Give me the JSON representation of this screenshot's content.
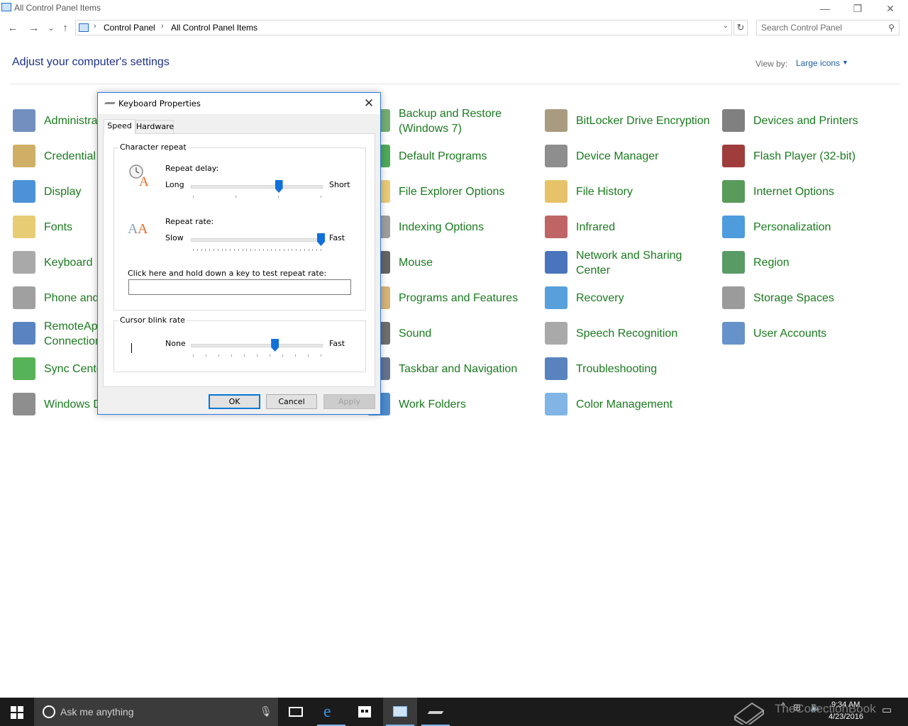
{
  "window": {
    "title": "All Control Panel Items",
    "minimize_glyph": "—",
    "restore_glyph": "❐",
    "close_glyph": "✕"
  },
  "nav": {
    "back_glyph": "←",
    "forward_glyph": "→",
    "recent_glyph": "⌄",
    "up_glyph": "↑",
    "breadcrumb": [
      "Control Panel",
      "All Control Panel Items"
    ],
    "crumb_separator": "›",
    "dropdown_glyph": "⌄",
    "refresh_glyph": "↻"
  },
  "search": {
    "placeholder": "Search Control Panel",
    "icon_glyph": "⚲"
  },
  "heading": "Adjust your computer's settings",
  "viewby": {
    "label": "View by:",
    "value": "Large icons",
    "caret": "▼"
  },
  "items": [
    {
      "label": "Administrative Tools",
      "icon": "administrative-tools-icon",
      "color": "#5a7bb5"
    },
    {
      "label": "Credential Manager",
      "icon": "credential-manager-icon",
      "color": "#c7a04a"
    },
    {
      "label": "Display",
      "icon": "display-icon",
      "color": "#2d7fd1"
    },
    {
      "label": "Fonts",
      "icon": "fonts-icon",
      "color": "#e3c35a"
    },
    {
      "label": "Keyboard",
      "icon": "keyboard-icon",
      "color": "#9a9a9a"
    },
    {
      "label": "Phone and Modem",
      "icon": "phone-modem-icon",
      "color": "#8f8f8f"
    },
    {
      "label": "RemoteApp and Desktop Connections",
      "icon": "remoteapp-icon",
      "color": "#3d6fb6"
    },
    {
      "label": "Sync Center",
      "icon": "sync-center-icon",
      "color": "#3aa63a"
    },
    {
      "label": "Windows Defender",
      "icon": "windows-defender-icon",
      "color": "#7a7a7a"
    },
    {
      "label": "Backup and Restore (Windows 7)",
      "icon": "backup-restore-icon",
      "color": "#5aa05a"
    },
    {
      "label": "Default Programs",
      "icon": "default-programs-icon",
      "color": "#2f9b3c"
    },
    {
      "label": "File Explorer Options",
      "icon": "file-explorer-options-icon",
      "color": "#e5c15f"
    },
    {
      "label": "Indexing Options",
      "icon": "indexing-options-icon",
      "color": "#8d8d8d"
    },
    {
      "label": "Mouse",
      "icon": "mouse-icon",
      "color": "#4a4a4a"
    },
    {
      "label": "Programs and Features",
      "icon": "programs-features-icon",
      "color": "#cfa65e"
    },
    {
      "label": "Sound",
      "icon": "sound-icon",
      "color": "#555555"
    },
    {
      "label": "Taskbar and Navigation",
      "icon": "taskbar-navigation-icon",
      "color": "#4a5a7a"
    },
    {
      "label": "Work Folders",
      "icon": "work-folders-icon",
      "color": "#2f78c4"
    },
    {
      "label": "BitLocker Drive Encryption",
      "icon": "bitlocker-icon",
      "color": "#9a8a6a"
    },
    {
      "label": "Device Manager",
      "icon": "device-manager-icon",
      "color": "#7a7a7a"
    },
    {
      "label": "File History",
      "icon": "file-history-icon",
      "color": "#e2b94e"
    },
    {
      "label": "Infrared",
      "icon": "infrared-icon",
      "color": "#b54a4a"
    },
    {
      "label": "Network and Sharing Center",
      "icon": "network-sharing-icon",
      "color": "#2a5db0"
    },
    {
      "label": "Recovery",
      "icon": "recovery-icon",
      "color": "#3a8fd6"
    },
    {
      "label": "Speech Recognition",
      "icon": "speech-recognition-icon",
      "color": "#9a9a9a"
    },
    {
      "label": "Troubleshooting",
      "icon": "troubleshooting-icon",
      "color": "#3b6db3"
    },
    {
      "label": "Color Management",
      "icon": "color-management-icon",
      "color": "#6aa8e0"
    },
    {
      "label": "Devices and Printers",
      "icon": "devices-printers-icon",
      "color": "#6a6a6a"
    },
    {
      "label": "Flash Player (32-bit)",
      "icon": "flash-player-icon",
      "color": "#8e1b1b"
    },
    {
      "label": "Internet Options",
      "icon": "internet-options-icon",
      "color": "#3c8a3c"
    },
    {
      "label": "Personalization",
      "icon": "personalization-icon",
      "color": "#2f8ad8"
    },
    {
      "label": "Region",
      "icon": "region-icon",
      "color": "#3b8a4a"
    },
    {
      "label": "Storage Spaces",
      "icon": "storage-spaces-icon",
      "color": "#8a8a8a"
    },
    {
      "label": "User Accounts",
      "icon": "user-accounts-icon",
      "color": "#4c7fbf"
    }
  ],
  "dialog": {
    "title": "Keyboard Properties",
    "close_glyph": "✕",
    "tabs": [
      "Speed",
      "Hardware"
    ],
    "char_repeat": {
      "legend": "Character repeat",
      "delay_label": "Repeat delay:",
      "delay_left": "Long",
      "delay_right": "Short",
      "delay_level": 0.67,
      "delay_ticks": 4,
      "rate_label": "Repeat rate:",
      "rate_left": "Slow",
      "rate_right": "Fast",
      "rate_level": 1.0,
      "rate_ticks": 32,
      "test_label": "Click here and hold down a key to test repeat rate:",
      "test_value": ""
    },
    "cursor_blink": {
      "legend": "Cursor blink rate",
      "left": "None",
      "right": "Fast",
      "level": 0.64,
      "ticks": 11
    },
    "buttons": {
      "ok": "OK",
      "cancel": "Cancel",
      "apply": "Apply"
    }
  },
  "taskbar": {
    "search_text": "Ask me anything",
    "time": "9:34 AM",
    "date": "4/23/2016",
    "watermark": "TheCollectionBook"
  }
}
